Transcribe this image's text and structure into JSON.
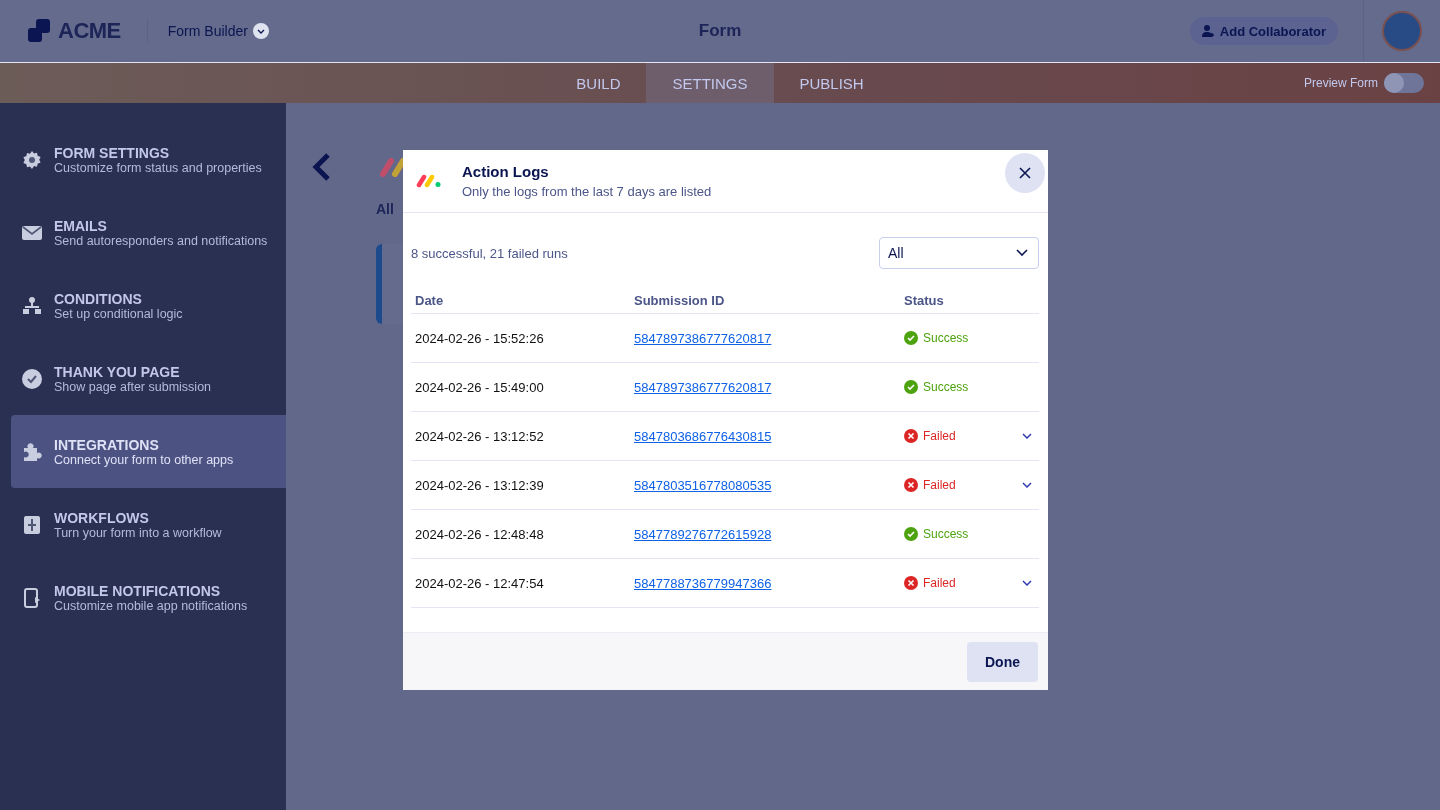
{
  "header": {
    "logo": "ACME",
    "product": "Form Builder",
    "title": "Form",
    "collaborator_button": "Add Collaborator"
  },
  "tabs": [
    {
      "label": "BUILD",
      "selected": false
    },
    {
      "label": "SETTINGS",
      "selected": true
    },
    {
      "label": "PUBLISH",
      "selected": false
    }
  ],
  "preview": {
    "label": "Preview Form",
    "on": false
  },
  "sidebar": {
    "items": [
      {
        "kind": "gear",
        "title": "FORM SETTINGS",
        "subtitle": "Customize form status and properties",
        "selected": false
      },
      {
        "kind": "mail",
        "title": "EMAILS",
        "subtitle": "Send autoresponders and notifications",
        "selected": false
      },
      {
        "kind": "tree",
        "title": "CONDITIONS",
        "subtitle": "Set up conditional logic",
        "selected": false
      },
      {
        "kind": "check",
        "title": "THANK YOU PAGE",
        "subtitle": "Show page after submission",
        "selected": false
      },
      {
        "kind": "puzzle",
        "title": "INTEGRATIONS",
        "subtitle": "Connect your form to other apps",
        "selected": true
      },
      {
        "kind": "flow",
        "title": "WORKFLOWS",
        "subtitle": "Turn your form into a workflow",
        "selected": false
      },
      {
        "kind": "phone",
        "title": "MOBILE NOTIFICATIONS",
        "subtitle": "Customize mobile app notifications",
        "selected": false
      }
    ]
  },
  "content": {
    "heading": "All"
  },
  "modal": {
    "title": "Action Logs",
    "subtitle": "Only the logs from the last 7 days are listed",
    "summary": "8 successful, 21 failed runs",
    "filter": "All",
    "columns": [
      "Date",
      "Submission ID",
      "Status"
    ],
    "rows": [
      {
        "date": "2024-02-26 - 15:52:26",
        "submission_id": "5847897386777620817",
        "status": "Success",
        "kind": "success"
      },
      {
        "date": "2024-02-26 - 15:49:00",
        "submission_id": "5847897386777620817",
        "status": "Success",
        "kind": "success"
      },
      {
        "date": "2024-02-26 - 13:12:52",
        "submission_id": "5847803686776430815",
        "status": "Failed",
        "kind": "failed"
      },
      {
        "date": "2024-02-26 - 13:12:39",
        "submission_id": "5847803516778080535",
        "status": "Failed",
        "kind": "failed"
      },
      {
        "date": "2024-02-26 - 12:48:48",
        "submission_id": "5847789276772615928",
        "status": "Success",
        "kind": "success"
      },
      {
        "date": "2024-02-26 - 12:47:54",
        "submission_id": "5847788736779947366",
        "status": "Failed",
        "kind": "failed"
      }
    ],
    "done_button": "Done"
  }
}
